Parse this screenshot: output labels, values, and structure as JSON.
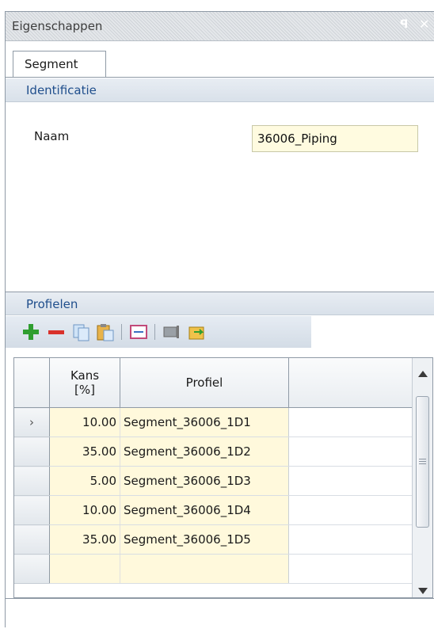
{
  "panel": {
    "title": "Eigenschappen",
    "pin_glyph": "ꟼ",
    "close_glyph": "✕"
  },
  "tabs": [
    {
      "label": "Segment"
    }
  ],
  "identificatie": {
    "header": "Identificatie",
    "naam_label": "Naam",
    "naam_value": "36006_Piping"
  },
  "profielen": {
    "header": "Profielen",
    "toolbar": [
      "add-icon",
      "remove-icon",
      "copy-icon",
      "paste-icon",
      "edit-profile-icon",
      "profile-settings-icon",
      "import-icon"
    ],
    "columns": {
      "row": "",
      "kans": "Kans\n[%]",
      "profiel": "Profiel",
      "extra": ""
    },
    "rows": [
      {
        "selected": true,
        "kans": "10.00",
        "profiel": "Segment_36006_1D1"
      },
      {
        "selected": false,
        "kans": "35.00",
        "profiel": "Segment_36006_1D2"
      },
      {
        "selected": false,
        "kans": "5.00",
        "profiel": "Segment_36006_1D3"
      },
      {
        "selected": false,
        "kans": "10.00",
        "profiel": "Segment_36006_1D4"
      },
      {
        "selected": false,
        "kans": "35.00",
        "profiel": "Segment_36006_1D5"
      },
      {
        "selected": false,
        "kans": "",
        "profiel": ""
      }
    ]
  },
  "colors": {
    "accent": "#1f4e8c",
    "cell_yellow": "#fff9dc",
    "border": "#8f9aa6"
  }
}
